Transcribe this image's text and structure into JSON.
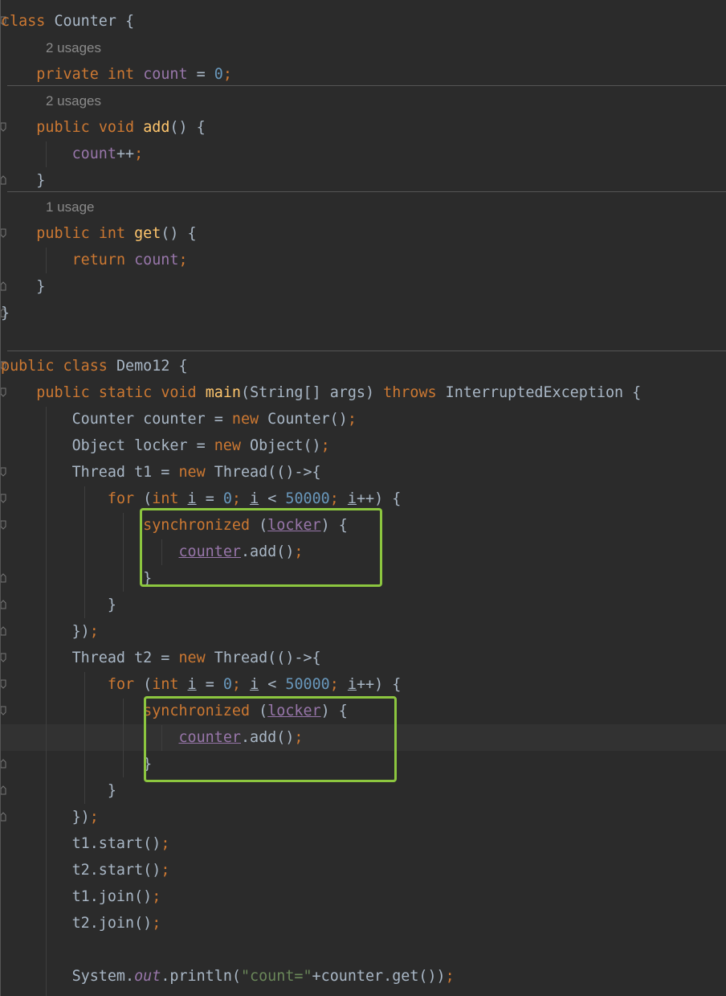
{
  "usages": {
    "count_field": "2 usages",
    "add_method": "2 usages",
    "get_method": "1 usage"
  },
  "code_lines": [
    "class Counter {",
    "    private int count = 0;",
    "    public void add() {",
    "        count++;",
    "    }",
    "    public int get() {",
    "        return count;",
    "    }",
    "}",
    "public class Demo12 {",
    "    public static void main(String[] args) throws InterruptedException {",
    "        Counter counter = new Counter();",
    "        Object locker = new Object();",
    "        Thread t1 = new Thread(()->{",
    "            for (int i = 0; i < 50000; i++) {",
    "                synchronized (locker) {",
    "                    counter.add();",
    "                }",
    "            }",
    "        });",
    "        Thread t2 = new Thread(()->{",
    "            for (int i = 0; i < 50000; i++) {",
    "                synchronized (locker) {",
    "                    counter.add();",
    "                }",
    "            }",
    "        });",
    "        t1.start();",
    "        t2.start();",
    "        t1.join();",
    "        t2.join();",
    "        System.out.println(\"count=\"+counter.get());"
  ],
  "highlight_color": "#8cc63f",
  "icons": {
    "gutter": "fold-marker-icon"
  }
}
